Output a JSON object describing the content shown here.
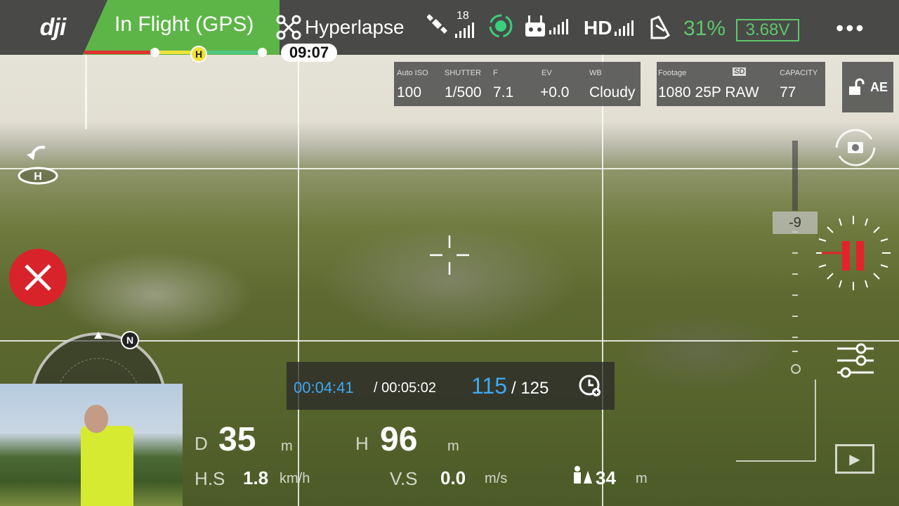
{
  "brand": {
    "logo": "dji"
  },
  "status": {
    "flight_mode": "In Flight (GPS)",
    "mode_icon": "drone-icon",
    "shooting_mode": "Hyperlapse",
    "satellites": "18",
    "rc_label": "HD",
    "battery_percent": "31%",
    "battery_voltage": "3.68V",
    "flight_time": "09:07",
    "home_marker": "H",
    "colors": {
      "status_green": "#5db548",
      "battery_green": "#5dc86a",
      "record_red": "#e3232b"
    }
  },
  "camera": {
    "iso_label": "Auto ISO",
    "iso": "100",
    "shutter_label": "SHUTTER",
    "shutter": "1/500",
    "f_label": "F",
    "f": "7.1",
    "ev_label": "EV",
    "ev": "+0.0",
    "wb_label": "WB",
    "wb": "Cloudy"
  },
  "storage": {
    "footage_label": "Footage",
    "sd_label": "SD",
    "footage": "1080 25P RAW",
    "capacity_label": "CAPACITY",
    "capacity": "77"
  },
  "ae": {
    "label": "AE"
  },
  "gimbal": {
    "value": "-9"
  },
  "hyperlapse": {
    "elapsed": "00:04:41",
    "total": "/ 00:05:02",
    "frames": "115",
    "frames_total": "/ 125"
  },
  "compass": {
    "north": "N"
  },
  "telemetry": {
    "d_label": "D",
    "d_value": "35",
    "d_unit": "m",
    "h_label": "H",
    "h_value": "96",
    "h_unit": "m",
    "hs_label": "H.S",
    "hs_value": "1.8",
    "hs_unit": "km/h",
    "vs_label": "V.S",
    "vs_value": "0.0",
    "vs_unit": "m/s",
    "pilot_distance": "34",
    "pilot_unit": "m"
  }
}
